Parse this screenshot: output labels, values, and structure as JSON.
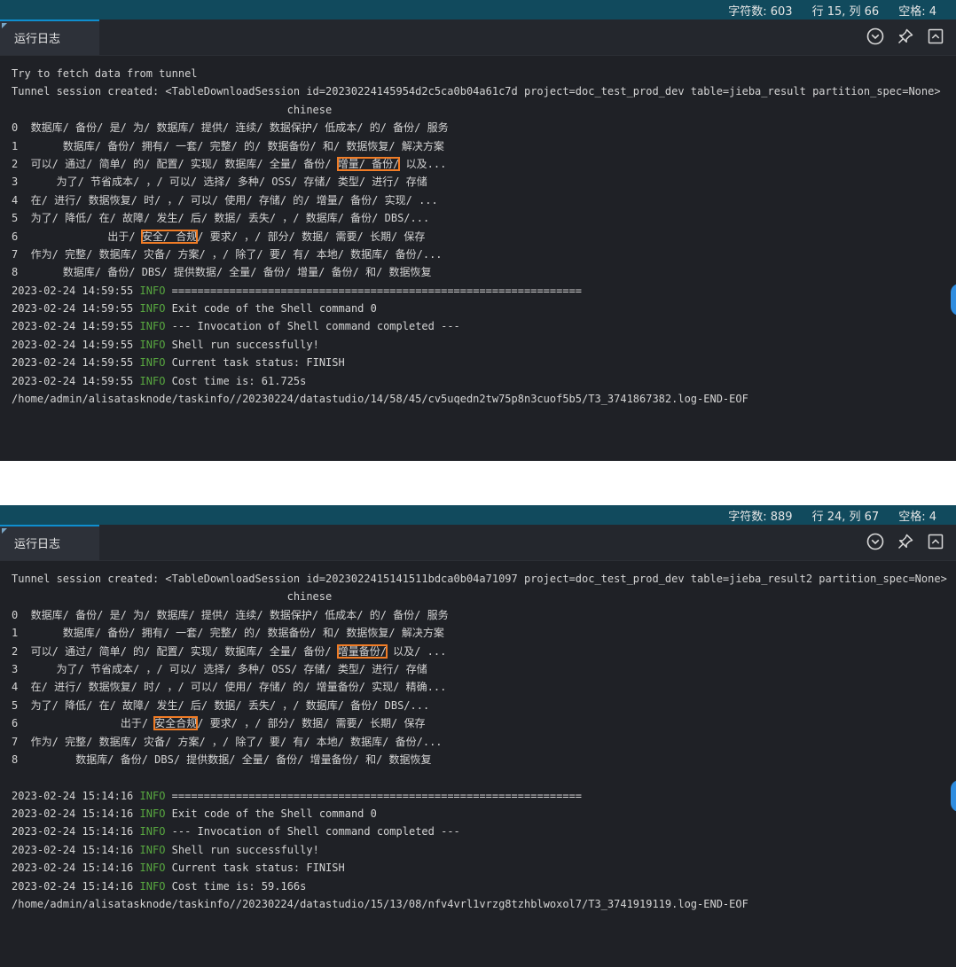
{
  "panels": [
    {
      "status": {
        "chars": "字符数: 603",
        "position": "行 15, 列 66",
        "spaces": "空格: 4"
      },
      "tab_label": "运行日志",
      "lines": [
        {
          "type": "plain",
          "text": "Try to fetch data from tunnel"
        },
        {
          "type": "plain",
          "text": "Tunnel session created: <TableDownloadSession id=20230224145954d2c5ca0b04a61c7d project=doc_test_prod_dev table=jieba_result partition_spec=None>"
        },
        {
          "type": "plain",
          "text": "                                           chinese"
        },
        {
          "type": "plain",
          "text": "0  数据库/ 备份/ 是/ 为/ 数据库/ 提供/ 连续/ 数据保护/ 低成本/ 的/ 备份/ 服务"
        },
        {
          "type": "plain",
          "text": "1       数据库/ 备份/ 拥有/ 一套/ 完整/ 的/ 数据备份/ 和/ 数据恢复/ 解决方案"
        },
        {
          "type": "hl",
          "pre": "2  可以/ 通过/ 简单/ 的/ 配置/ 实现/ 数据库/ 全量/ 备份/ ",
          "hl": "增量/ 备份/",
          "post": " 以及..."
        },
        {
          "type": "plain",
          "text": "3      为了/ 节省成本/ ，/ 可以/ 选择/ 多种/ OSS/ 存储/ 类型/ 进行/ 存储"
        },
        {
          "type": "plain",
          "text": "4  在/ 进行/ 数据恢复/ 时/ ，/ 可以/ 使用/ 存储/ 的/ 增量/ 备份/ 实现/ ..."
        },
        {
          "type": "plain",
          "text": "5  为了/ 降低/ 在/ 故障/ 发生/ 后/ 数据/ 丢失/ ，/ 数据库/ 备份/ DBS/..."
        },
        {
          "type": "hl",
          "pre": "6              出于/ ",
          "hl": "安全/ 合规",
          "post": "/ 要求/ ，/ 部分/ 数据/ 需要/ 长期/ 保存"
        },
        {
          "type": "plain",
          "text": "7  作为/ 完整/ 数据库/ 灾备/ 方案/ ，/ 除了/ 要/ 有/ 本地/ 数据库/ 备份/..."
        },
        {
          "type": "plain",
          "text": "8       数据库/ 备份/ DBS/ 提供数据/ 全量/ 备份/ 增量/ 备份/ 和/ 数据恢复"
        },
        {
          "type": "log",
          "ts": "2023-02-24 14:59:55",
          "level": "INFO",
          "msg": "================================================================"
        },
        {
          "type": "log",
          "ts": "2023-02-24 14:59:55",
          "level": "INFO",
          "msg": "Exit code of the Shell command 0"
        },
        {
          "type": "log",
          "ts": "2023-02-24 14:59:55",
          "level": "INFO",
          "msg": "--- Invocation of Shell command completed ---"
        },
        {
          "type": "log",
          "ts": "2023-02-24 14:59:55",
          "level": "INFO",
          "msg": "Shell run successfully!"
        },
        {
          "type": "log",
          "ts": "2023-02-24 14:59:55",
          "level": "INFO",
          "msg": "Current task status: FINISH"
        },
        {
          "type": "log",
          "ts": "2023-02-24 14:59:55",
          "level": "INFO",
          "msg": "Cost time is: 61.725s"
        },
        {
          "type": "plain",
          "text": "/home/admin/alisatasknode/taskinfo//20230224/datastudio/14/58/45/cv5uqedn2tw75p8n3cuof5b5/T3_3741867382.log-END-EOF"
        }
      ]
    },
    {
      "status": {
        "chars": "字符数: 889",
        "position": "行 24, 列 67",
        "spaces": "空格: 4"
      },
      "tab_label": "运行日志",
      "lines": [
        {
          "type": "plain",
          "text": "Tunnel session created: <TableDownloadSession id=2023022415141511bdca0b04a71097 project=doc_test_prod_dev table=jieba_result2 partition_spec=None>"
        },
        {
          "type": "plain",
          "text": "                                           chinese"
        },
        {
          "type": "plain",
          "text": "0  数据库/ 备份/ 是/ 为/ 数据库/ 提供/ 连续/ 数据保护/ 低成本/ 的/ 备份/ 服务"
        },
        {
          "type": "plain",
          "text": "1       数据库/ 备份/ 拥有/ 一套/ 完整/ 的/ 数据备份/ 和/ 数据恢复/ 解决方案"
        },
        {
          "type": "hl",
          "pre": "2  可以/ 通过/ 简单/ 的/ 配置/ 实现/ 数据库/ 全量/ 备份/ ",
          "hl": "增量备份/",
          "post": " 以及/ ..."
        },
        {
          "type": "plain",
          "text": "3      为了/ 节省成本/ ，/ 可以/ 选择/ 多种/ OSS/ 存储/ 类型/ 进行/ 存储"
        },
        {
          "type": "plain",
          "text": "4  在/ 进行/ 数据恢复/ 时/ ，/ 可以/ 使用/ 存储/ 的/ 增量备份/ 实现/ 精确..."
        },
        {
          "type": "plain",
          "text": "5  为了/ 降低/ 在/ 故障/ 发生/ 后/ 数据/ 丢失/ ，/ 数据库/ 备份/ DBS/..."
        },
        {
          "type": "hl",
          "pre": "6                出于/ ",
          "hl": "安全合规",
          "post": "/ 要求/ ，/ 部分/ 数据/ 需要/ 长期/ 保存"
        },
        {
          "type": "plain",
          "text": "7  作为/ 完整/ 数据库/ 灾备/ 方案/ ，/ 除了/ 要/ 有/ 本地/ 数据库/ 备份/..."
        },
        {
          "type": "plain",
          "text": "8         数据库/ 备份/ DBS/ 提供数据/ 全量/ 备份/ 增量备份/ 和/ 数据恢复"
        },
        {
          "type": "plain",
          "text": ""
        },
        {
          "type": "log",
          "ts": "2023-02-24 15:14:16",
          "level": "INFO",
          "msg": "================================================================"
        },
        {
          "type": "log",
          "ts": "2023-02-24 15:14:16",
          "level": "INFO",
          "msg": "Exit code of the Shell command 0"
        },
        {
          "type": "log",
          "ts": "2023-02-24 15:14:16",
          "level": "INFO",
          "msg": "--- Invocation of Shell command completed ---"
        },
        {
          "type": "log",
          "ts": "2023-02-24 15:14:16",
          "level": "INFO",
          "msg": "Shell run successfully!"
        },
        {
          "type": "log",
          "ts": "2023-02-24 15:14:16",
          "level": "INFO",
          "msg": "Current task status: FINISH"
        },
        {
          "type": "log",
          "ts": "2023-02-24 15:14:16",
          "level": "INFO",
          "msg": "Cost time is: 59.166s"
        },
        {
          "type": "plain",
          "text": "/home/admin/alisatasknode/taskinfo//20230224/datastudio/15/13/08/nfv4vrl1vrzg8tzhblwoxol7/T3_3741919119.log-END-EOF"
        }
      ]
    }
  ]
}
